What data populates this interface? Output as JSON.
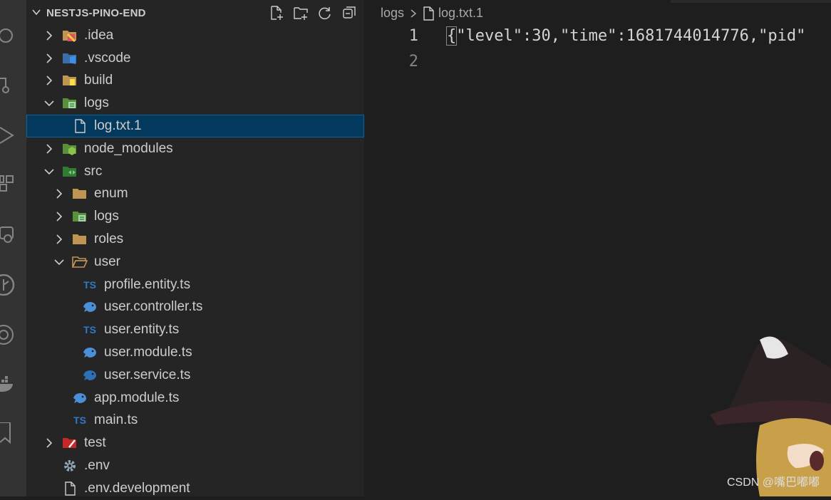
{
  "explorer": {
    "title": "NESTJS-PINO-END",
    "actions": [
      {
        "name": "new-file-icon"
      },
      {
        "name": "new-folder-icon"
      },
      {
        "name": "refresh-icon"
      },
      {
        "name": "collapse-all-icon"
      }
    ],
    "tree": [
      {
        "label": ".idea",
        "depth": 0,
        "chevron": "right",
        "icon": "idea-folder-icon",
        "iconColor": "#e8c14d"
      },
      {
        "label": ".vscode",
        "depth": 0,
        "chevron": "right",
        "icon": "vscode-folder-icon",
        "iconColor": "#3b8eea"
      },
      {
        "label": "build",
        "depth": 0,
        "chevron": "right",
        "icon": "build-folder-icon",
        "iconColor": "#dcb346"
      },
      {
        "label": "logs",
        "depth": 0,
        "chevron": "down",
        "icon": "logs-folder-icon",
        "iconColor": "#8bc34a"
      },
      {
        "label": "log.txt.1",
        "depth": 1,
        "chevron": "none",
        "icon": "file-icon",
        "selected": true
      },
      {
        "label": "node_modules",
        "depth": 0,
        "chevron": "right",
        "icon": "node-folder-icon",
        "iconColor": "#8bc34a"
      },
      {
        "label": "src",
        "depth": 0,
        "chevron": "down",
        "icon": "src-folder-icon",
        "iconColor": "#4caf50"
      },
      {
        "label": "enum",
        "depth": 1,
        "chevron": "right",
        "icon": "folder-icon",
        "iconColor": "#c09553"
      },
      {
        "label": "logs",
        "depth": 1,
        "chevron": "right",
        "icon": "logs-folder-icon",
        "iconColor": "#8bc34a"
      },
      {
        "label": "roles",
        "depth": 1,
        "chevron": "right",
        "icon": "folder-icon",
        "iconColor": "#c09553"
      },
      {
        "label": "user",
        "depth": 1,
        "chevron": "down",
        "icon": "folder-open-icon",
        "iconColor": "#c09553"
      },
      {
        "label": "profile.entity.ts",
        "depth": 2,
        "chevron": "none",
        "icon": "typescript-icon",
        "badge": "TS"
      },
      {
        "label": "user.controller.ts",
        "depth": 2,
        "chevron": "none",
        "icon": "nest-controller-icon",
        "iconColor": "#4a90d9"
      },
      {
        "label": "user.entity.ts",
        "depth": 2,
        "chevron": "none",
        "icon": "typescript-icon",
        "badge": "TS"
      },
      {
        "label": "user.module.ts",
        "depth": 2,
        "chevron": "none",
        "icon": "nest-module-icon",
        "iconColor": "#4a90d9"
      },
      {
        "label": "user.service.ts",
        "depth": 2,
        "chevron": "none",
        "icon": "nest-service-icon",
        "iconColor": "#2f6fb3"
      },
      {
        "label": "app.module.ts",
        "depth": 1,
        "chevron": "none",
        "icon": "nest-module-icon",
        "iconColor": "#4a90d9"
      },
      {
        "label": "main.ts",
        "depth": 1,
        "chevron": "none",
        "icon": "typescript-icon",
        "badge": "TS"
      },
      {
        "label": "test",
        "depth": 0,
        "chevron": "right",
        "icon": "test-folder-icon",
        "iconColor": "#e53935"
      },
      {
        "label": ".env",
        "depth": 0,
        "chevron": "none",
        "icon": "gear-icon",
        "iconColor": "#8fa7b7"
      },
      {
        "label": ".env.development",
        "depth": 0,
        "chevron": "none",
        "icon": "file-icon"
      }
    ]
  },
  "editor": {
    "breadcrumb": [
      "logs",
      "log.txt.1"
    ],
    "lines": [
      {
        "number": "1",
        "text": "{\"level\":30,\"time\":1681744014776,\"pid\""
      },
      {
        "number": "2",
        "text": ""
      }
    ]
  },
  "watermark": "CSDN @嘴巴嘟嘟"
}
